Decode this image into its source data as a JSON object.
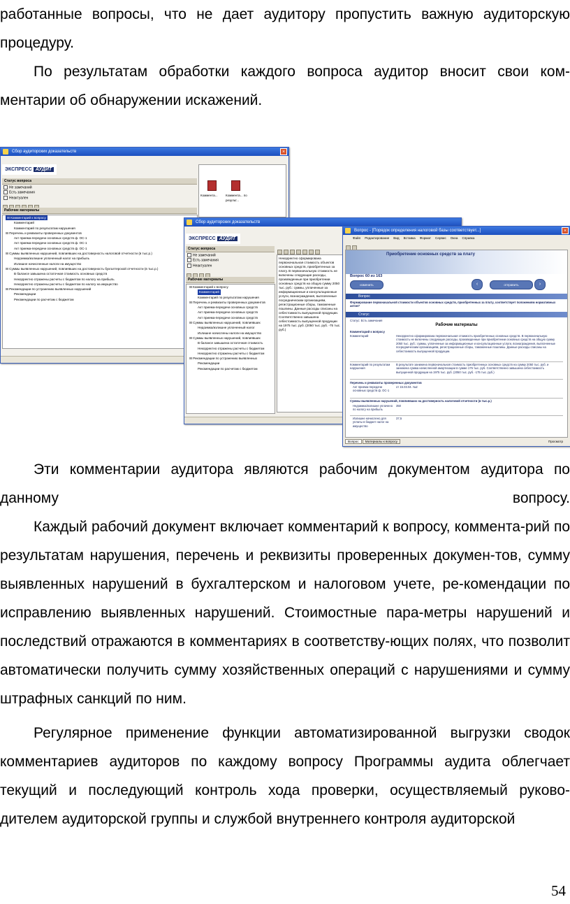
{
  "page": {
    "paragraph_1": "работанные вопросы, что не дает аудитору пропустить важную аудиторскую процедуру.",
    "paragraph_2": "По результатам обработки каждого вопроса аудитор вносит свои ком-ментарии об обнаружении искажений.",
    "paragraph_3": "Эти комментарии аудитора являются рабочим документом аудитора по данному вопросу.",
    "paragraph_4": "Каждый рабочий документ включает комментарий к вопросу, коммента-рий по результатам нарушения, перечень и реквизиты проверенных докумен-тов, сумму выявленных нарушений в бухгалтерском и налоговом учете, ре-комендации по исправлению выявленных нарушений. Стоимостные пара-метры нарушений и последствий отражаются в комментариях в соответству-ющих полях, что позволит автоматически получить сумму хозяйственных операций с нарушениями и сумму штрафных санкций по ним.",
    "paragraph_5": "Регулярное применение функции автоматизированной выгрузки сводок комментариев аудиторов по каждому вопросу Программы аудита облегчает текущий и последующий контроль хода проверки, осуществляемый руково-дителем аудиторской группы и службой внутреннего контроля аудиторской",
    "page_number": "54"
  },
  "screenshot": {
    "window1": {
      "title": "Сбор аудиторских доказательств",
      "logo_left": "ЭКСПРЕСС",
      "logo_right": "АУДИТ",
      "status_header": "Статус вопроса",
      "status_options": [
        "Не замечаний",
        "Есть замечания",
        "Неактуален"
      ],
      "materials_header": "Рабочие материалы",
      "tree": [
        {
          "label": "Комментарий к вопросу",
          "level": 1,
          "selected": true
        },
        {
          "label": "Комментарий",
          "level": 2
        },
        {
          "label": "Комментарий по результатам нарушения",
          "level": 2
        },
        {
          "label": "Перечень и реквизиты проверенных документов",
          "level": 1
        },
        {
          "label": "Акт приема-передачи основных средств ф. ОС-1",
          "level": 2
        },
        {
          "label": "Акт приема-передачи основных средств ф. ОС-1",
          "level": 2
        },
        {
          "label": "Акт приема-передачи основных средств ф. ОС-1",
          "level": 2
        },
        {
          "label": "Суммы выявленных нарушений, повлиявших на достоверность налоговой отчетности (в тыс.р.)",
          "level": 1
        },
        {
          "label": "Недоимка/излишне уплаченный налог на прибыль",
          "level": 2
        },
        {
          "label": "Излишне начисленные налоги на имущество",
          "level": 2
        },
        {
          "label": "Суммы выявленных нарушений, повлиявших на достоверность бухгалтерской отчетности (в тыс.р.)",
          "level": 1
        },
        {
          "label": "В балансе завышена остаточная стоимость основных средств",
          "level": 2
        },
        {
          "label": "Некорректно отражены расчеты с бюджетом по налогу на прибыль",
          "level": 2
        },
        {
          "label": "Некорректно отражены расчеты с бюджетом по налогу на имущество",
          "level": 2
        },
        {
          "label": "Рекомендации по устранению выявленных нарушений",
          "level": 1
        },
        {
          "label": "Рекомендации",
          "level": 2
        },
        {
          "label": "Рекомендации по расчетам с бюджетом",
          "level": 2
        }
      ],
      "doc_buttons": [
        "Коммента...",
        "Коммента... по результ..."
      ]
    },
    "window2": {
      "title": "Сбор аудиторских доказательств",
      "status_header": "Статус вопроса",
      "status_options": [
        "Не замечаний",
        "Есть замечания",
        "Неактуален"
      ],
      "materials_header": "Рабочие материалы",
      "tree": [
        {
          "label": "Комментарий к вопросу",
          "level": 1
        },
        {
          "label": "Комментарий",
          "level": 2,
          "selected": true
        },
        {
          "label": "Комментарий по результатам нарушения",
          "level": 2
        },
        {
          "label": "Перечень и реквизиты проверенных документов",
          "level": 1
        },
        {
          "label": "Акт приема-передачи основных средств",
          "level": 2
        },
        {
          "label": "Акт приема-передачи основных средств",
          "level": 2
        },
        {
          "label": "Акт приема-передачи основных средств",
          "level": 2
        },
        {
          "label": "Суммы выявленных нарушений, повлиявших",
          "level": 1
        },
        {
          "label": "Недоимка/излишне уплаченный налог",
          "level": 2
        },
        {
          "label": "Излишне начислены налоги на имущество",
          "level": 2
        },
        {
          "label": "Суммы выявленных нарушений, повлиявших",
          "level": 1
        },
        {
          "label": "В балансе завышена остаточная стоимость",
          "level": 2
        },
        {
          "label": "Некорректно отражены расчеты с бюджетом",
          "level": 2
        },
        {
          "label": "Некорректно отражены расчеты с бюджетом",
          "level": 2
        },
        {
          "label": "Рекомендации по устранению выявленных",
          "level": 1
        },
        {
          "label": "Рекомендации",
          "level": 2
        },
        {
          "label": "Рекомендации по расчетам с бюджетом",
          "level": 2
        }
      ],
      "editor_text": "Некорректно сформирована первоначальная стоимость объектов основных средств, приобретенных за плату. В первоначальную стоимость не включены следующие расходы, произведенные при приобретении основных средств на общую сумму 2050 тыс. руб.: суммы, уплаченные за информационные и консультационные услуги, вознаграждения, выплаченные посредническим организациям, регистрационные сборы, таможенные пошлины. Данные расходы списаны на себестоимость выпущенной продукции. Соответственно завышена себестоимость выпущенной продукции на 1975 тыс. руб. (2050 тыс. руб. -75 тыс. руб.)"
    },
    "window3": {
      "title": "Вопрос - [Порядок определения налоговой базы соответствует...]",
      "menu": [
        "Файл",
        "Редактирование",
        "Вид",
        "Вставка",
        "Формат",
        "Сервис",
        "Окна",
        "Справка"
      ],
      "banner_title": "Приобретение основных средств за плату",
      "question_counter": "Вопрос 60 из 163",
      "btn_left": "изменить",
      "btn_right": "отправить",
      "section_question": "Вопрос",
      "question_text": "Формирование первоначальной стоимости объектов основных средств, приобретенных за плату, соответствует положениям нормативных актов?",
      "section_status": "Статус",
      "status_value": "Статус: Есть замечания",
      "materials_title": "Рабочие материалы",
      "comment_group": "Комментарий к вопросу",
      "comment_label": "Комментарий",
      "comment_text": "Некорректно сформирована первоначальная стоимость приобретенных основных средств. В первоначальную стоимость не включены следующие расходы, произведенные при приобретении основных средств на общую сумму 2050 тыс. руб.: суммы, уплаченные за информационные и консультационные услуги, вознаграждения, выплаченные посредническим организациям, регистрационные сборы, таможенные пошлины. Данные расходы списаны на себестоимость выпущенной продукции.",
      "result_label": "Комментарий по результатам нарушения",
      "result_text": "В результате занижена первоначальная стоимость приобретенных основных средств на сумму 2050 тыс. руб. и занижена сумма начисленной амортизации в сумме 175 тыс. руб. Соответственно завышена себестоимость выпущенной продукции на 1975 тыс. руб. (2050 тыс. руб. -175 тыс. руб.)",
      "docs_group": "Перечень и реквизиты проверенных документов",
      "docs_row_label": "Акт приема-передачи основных средств ф. ОС-1",
      "docs_row_value": "от 15.03.04. №2",
      "sums_group": "Суммы выявленных нарушений, повлиявших на достоверность налоговой отчетности (в тыс.р.)",
      "sum1_label": "Недоимка/излишне уплачено по налогу на прибыль",
      "sum1_value": "350",
      "sum2_label": "Излишне начислено для уплаты в бюджет налог на имущество",
      "sum2_value": "37,5",
      "tabs": [
        "Вопрос",
        "Материалы к вопросу"
      ],
      "status_right": "Просмотр"
    }
  }
}
